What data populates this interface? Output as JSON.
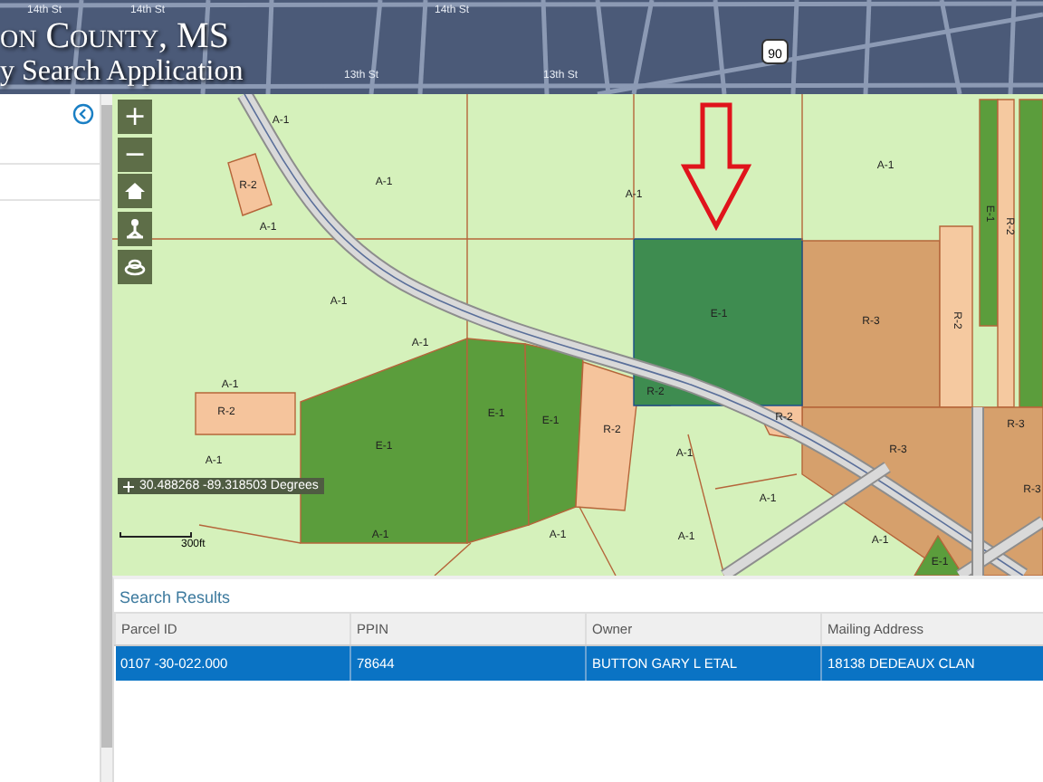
{
  "header": {
    "title": "on County, MS",
    "subtitle": "y Search Application",
    "street_labels": [
      "14th St",
      "14th St",
      "13th St",
      "14th St",
      "13th St"
    ],
    "route_shield": "90"
  },
  "map": {
    "zoom_in": "+",
    "zoom_out": "−",
    "zoning_labels": [
      "A-1",
      "A-1",
      "R-2",
      "A-1",
      "A-1",
      "A-1",
      "E-1",
      "R-3",
      "R-2",
      "E-1",
      "R-2",
      "A-1",
      "A-1",
      "A-1",
      "R-2",
      "E-1",
      "E-1",
      "E-1",
      "R-2",
      "R-2",
      "R-2",
      "R-3",
      "R-3",
      "A-1",
      "A-1",
      "A-1",
      "A-1",
      "A-1",
      "A-1",
      "A-1",
      "R-3",
      "E-1"
    ],
    "coordinates": "30.488268 -89.318503 Degrees",
    "scale": "300ft"
  },
  "search_results": {
    "title": "Search Results",
    "columns": [
      "Parcel ID",
      "PPIN",
      "Owner",
      "Mailing Address"
    ],
    "rows": [
      {
        "cells": [
          "0107 -30-022.000",
          "78644",
          "BUTTON GARY L ETAL",
          "18138 DEDEAUX CLAN"
        ],
        "selected": true
      }
    ]
  }
}
